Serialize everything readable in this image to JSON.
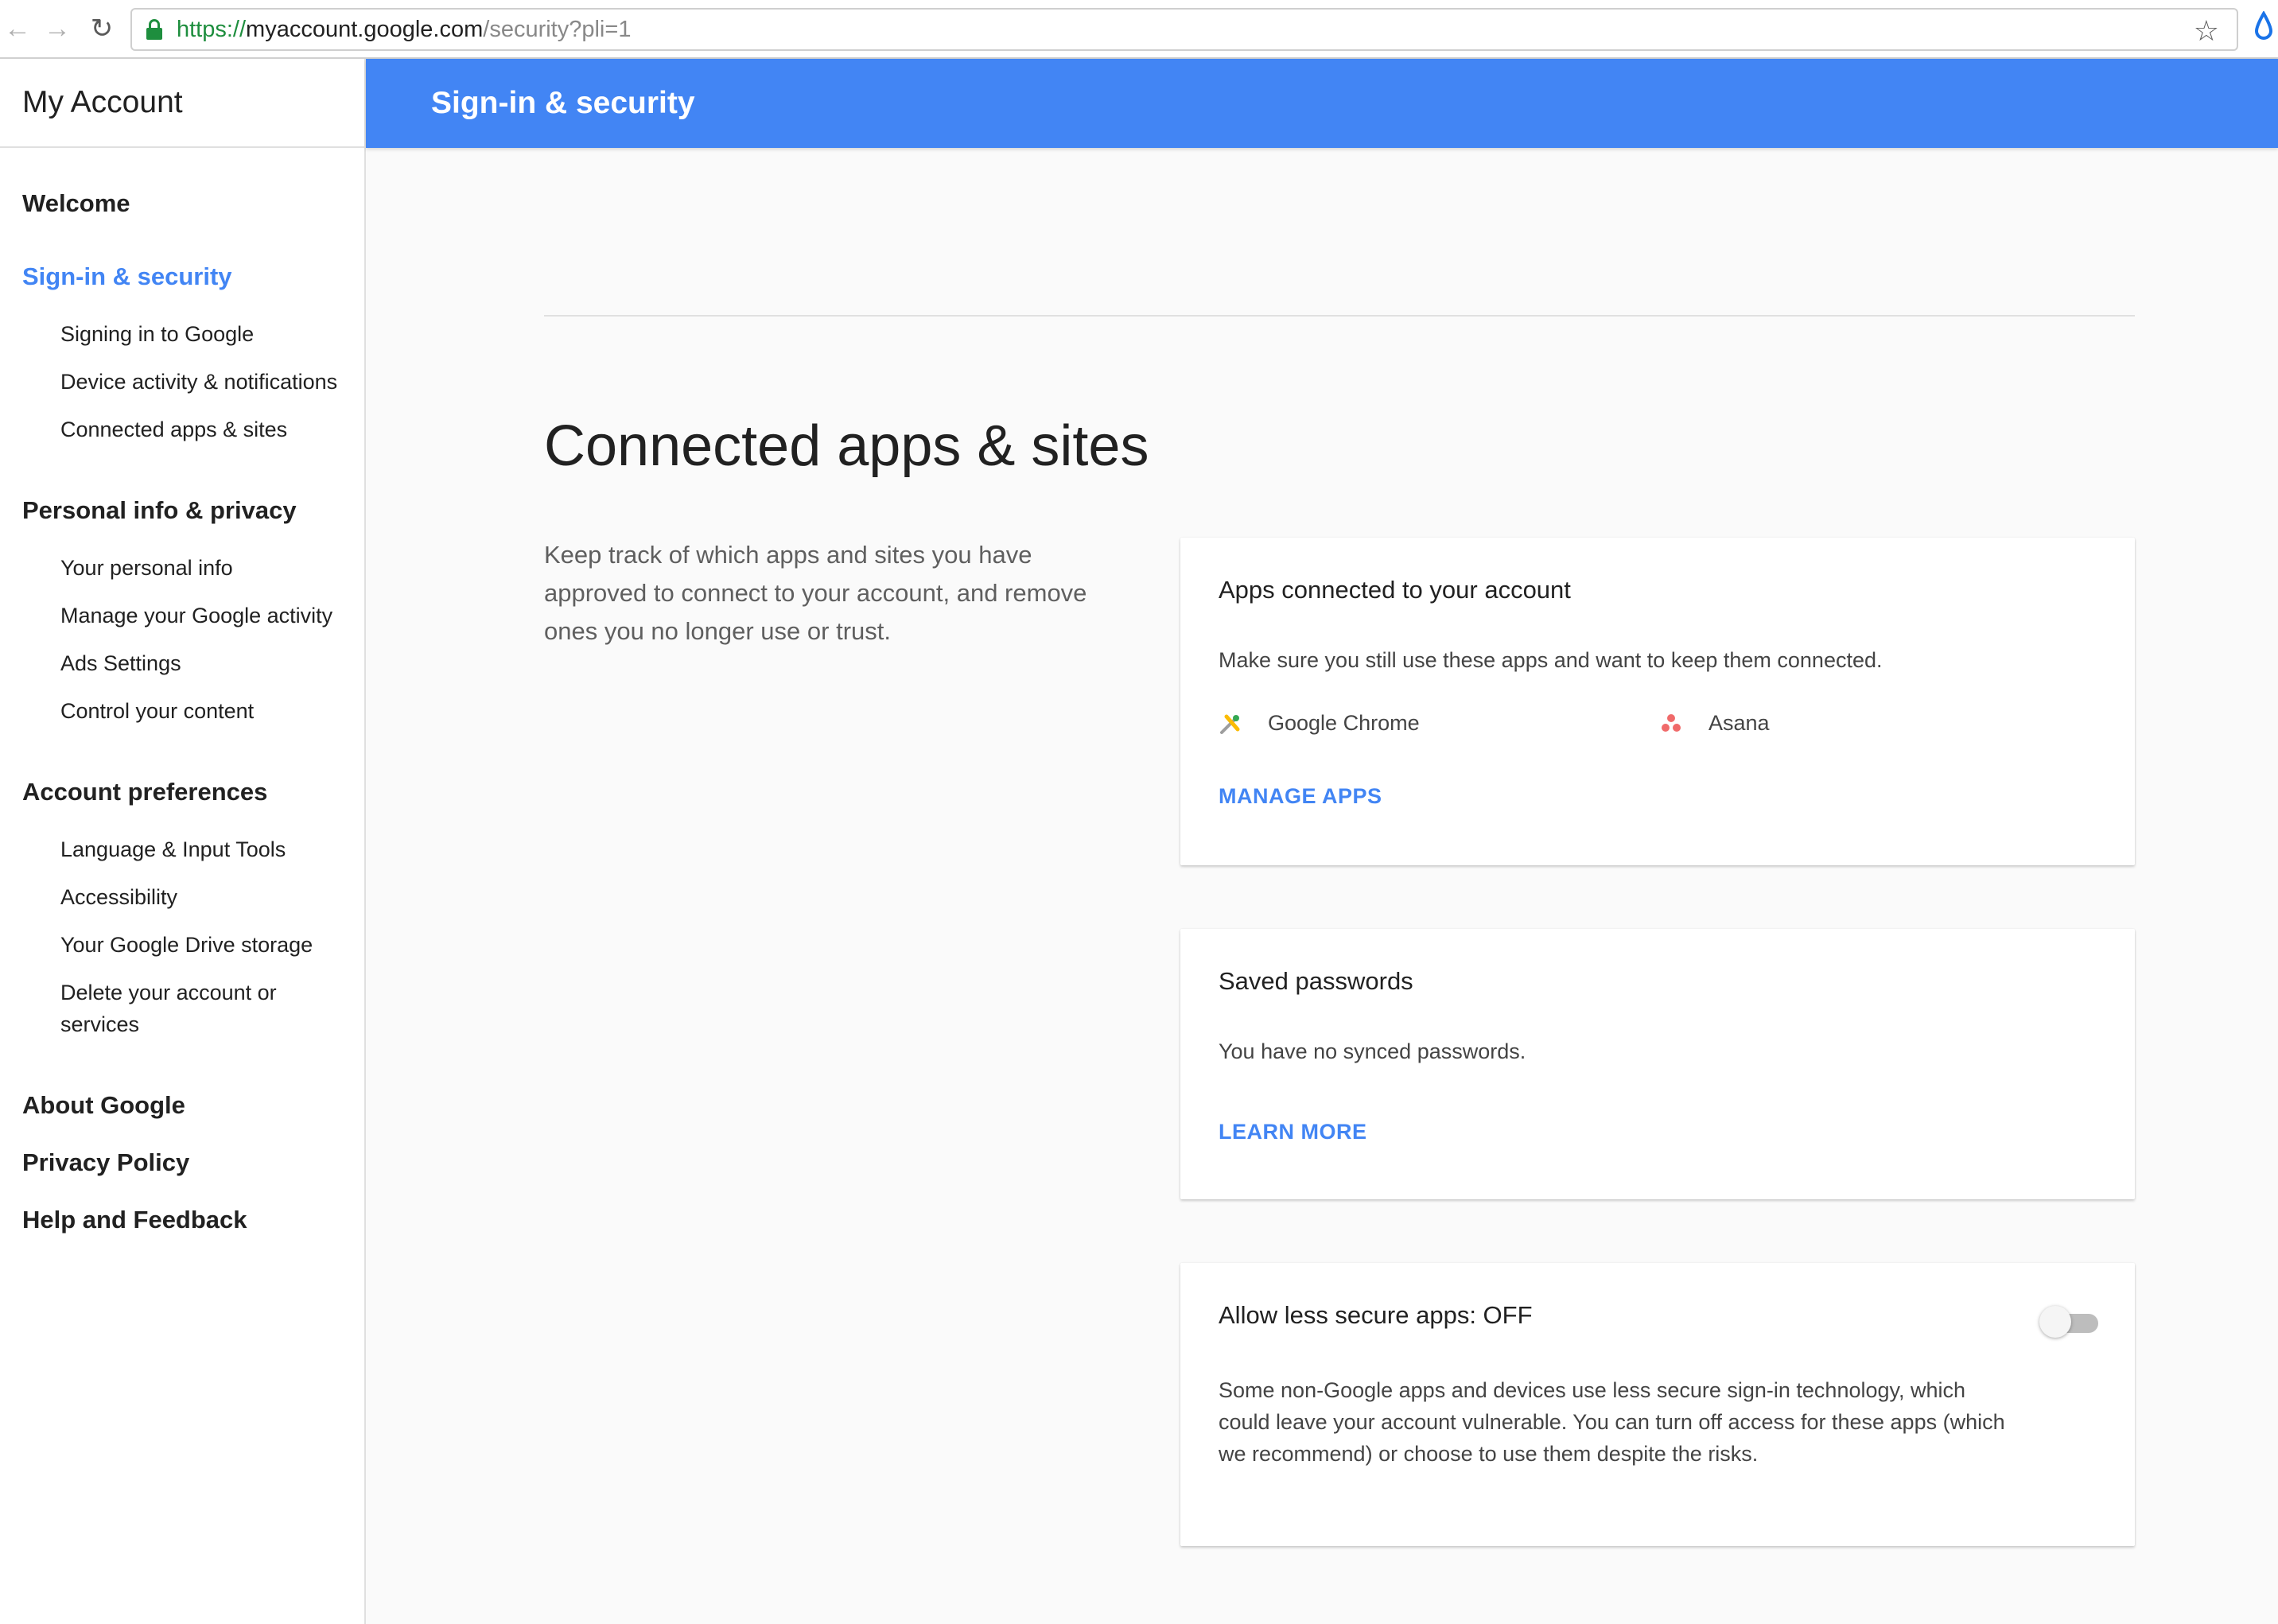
{
  "browser": {
    "url_scheme": "https://",
    "url_host": "myaccount.google.com",
    "url_path": "/security?pli=1",
    "back_icon": "←",
    "forward_icon": "→",
    "reload_icon": "↻",
    "star_icon": "☆"
  },
  "sidebar": {
    "title": "My Account",
    "welcome": "Welcome",
    "signin_security": {
      "label": "Sign-in & security",
      "items": [
        "Signing in to Google",
        "Device activity & notifications",
        "Connected apps & sites"
      ]
    },
    "personal_info": {
      "label": "Personal info & privacy",
      "items": [
        "Your personal info",
        "Manage your Google activity",
        "Ads Settings",
        "Control your content"
      ]
    },
    "account_prefs": {
      "label": "Account preferences",
      "items": [
        "Language & Input Tools",
        "Accessibility",
        "Your Google Drive storage",
        "Delete your account or services"
      ]
    },
    "about": "About Google",
    "privacy": "Privacy Policy",
    "help": "Help and Feedback"
  },
  "header": {
    "title": "Sign-in & security"
  },
  "main": {
    "title": "Connected apps & sites",
    "description": "Keep track of which apps and sites you have approved to connect to your account, and remove ones you no longer use or trust."
  },
  "apps_card": {
    "title": "Apps connected to your account",
    "text": "Make sure you still use these apps and want to keep them connected.",
    "apps": [
      "Google Chrome",
      "Asana"
    ],
    "link": "MANAGE APPS"
  },
  "passwords_card": {
    "title": "Saved passwords",
    "text": "You have no synced passwords.",
    "link": "LEARN MORE"
  },
  "less_secure_card": {
    "title": "Allow less secure apps: OFF",
    "text": "Some non-Google apps and devices use less secure sign-in technology, which could leave your account vulnerable. You can turn off access for these apps (which we recommend) or choose to use them despite the risks.",
    "toggle_state": "off"
  },
  "colors": {
    "accent": "#4285f4",
    "header_bg": "#4285f4",
    "asana": "#f06a6a"
  }
}
